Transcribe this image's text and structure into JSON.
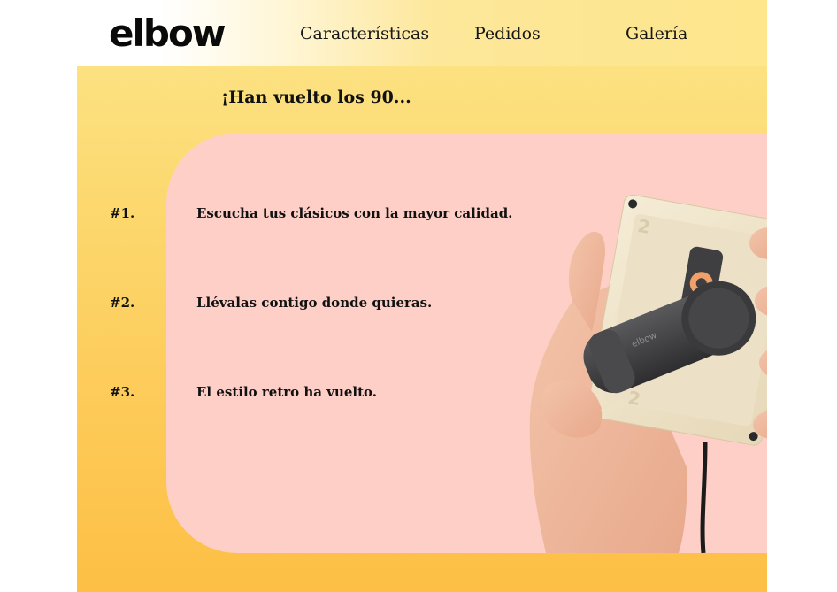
{
  "nav": {
    "logo": "elbow",
    "links": [
      "Características",
      "Pedidos",
      "Galería"
    ]
  },
  "hero": {
    "headline": "¡Han vuelto los 90..."
  },
  "features": [
    {
      "num": "#1.",
      "text": "Escucha tus clásicos con la mayor calidad."
    },
    {
      "num": "#2.",
      "text": "Llévalas contigo donde quieras."
    },
    {
      "num": "#3.",
      "text": "El estilo retro ha vuelto."
    }
  ],
  "product_image": {
    "icon": "hand-holding-cassette-player-image",
    "device_label": "elbow",
    "cassette_side_mark": "2"
  },
  "colors": {
    "background_top": "#fde68b",
    "background_bottom": "#fdbf45",
    "panel": "#fdcfc7",
    "text": "#111111"
  }
}
